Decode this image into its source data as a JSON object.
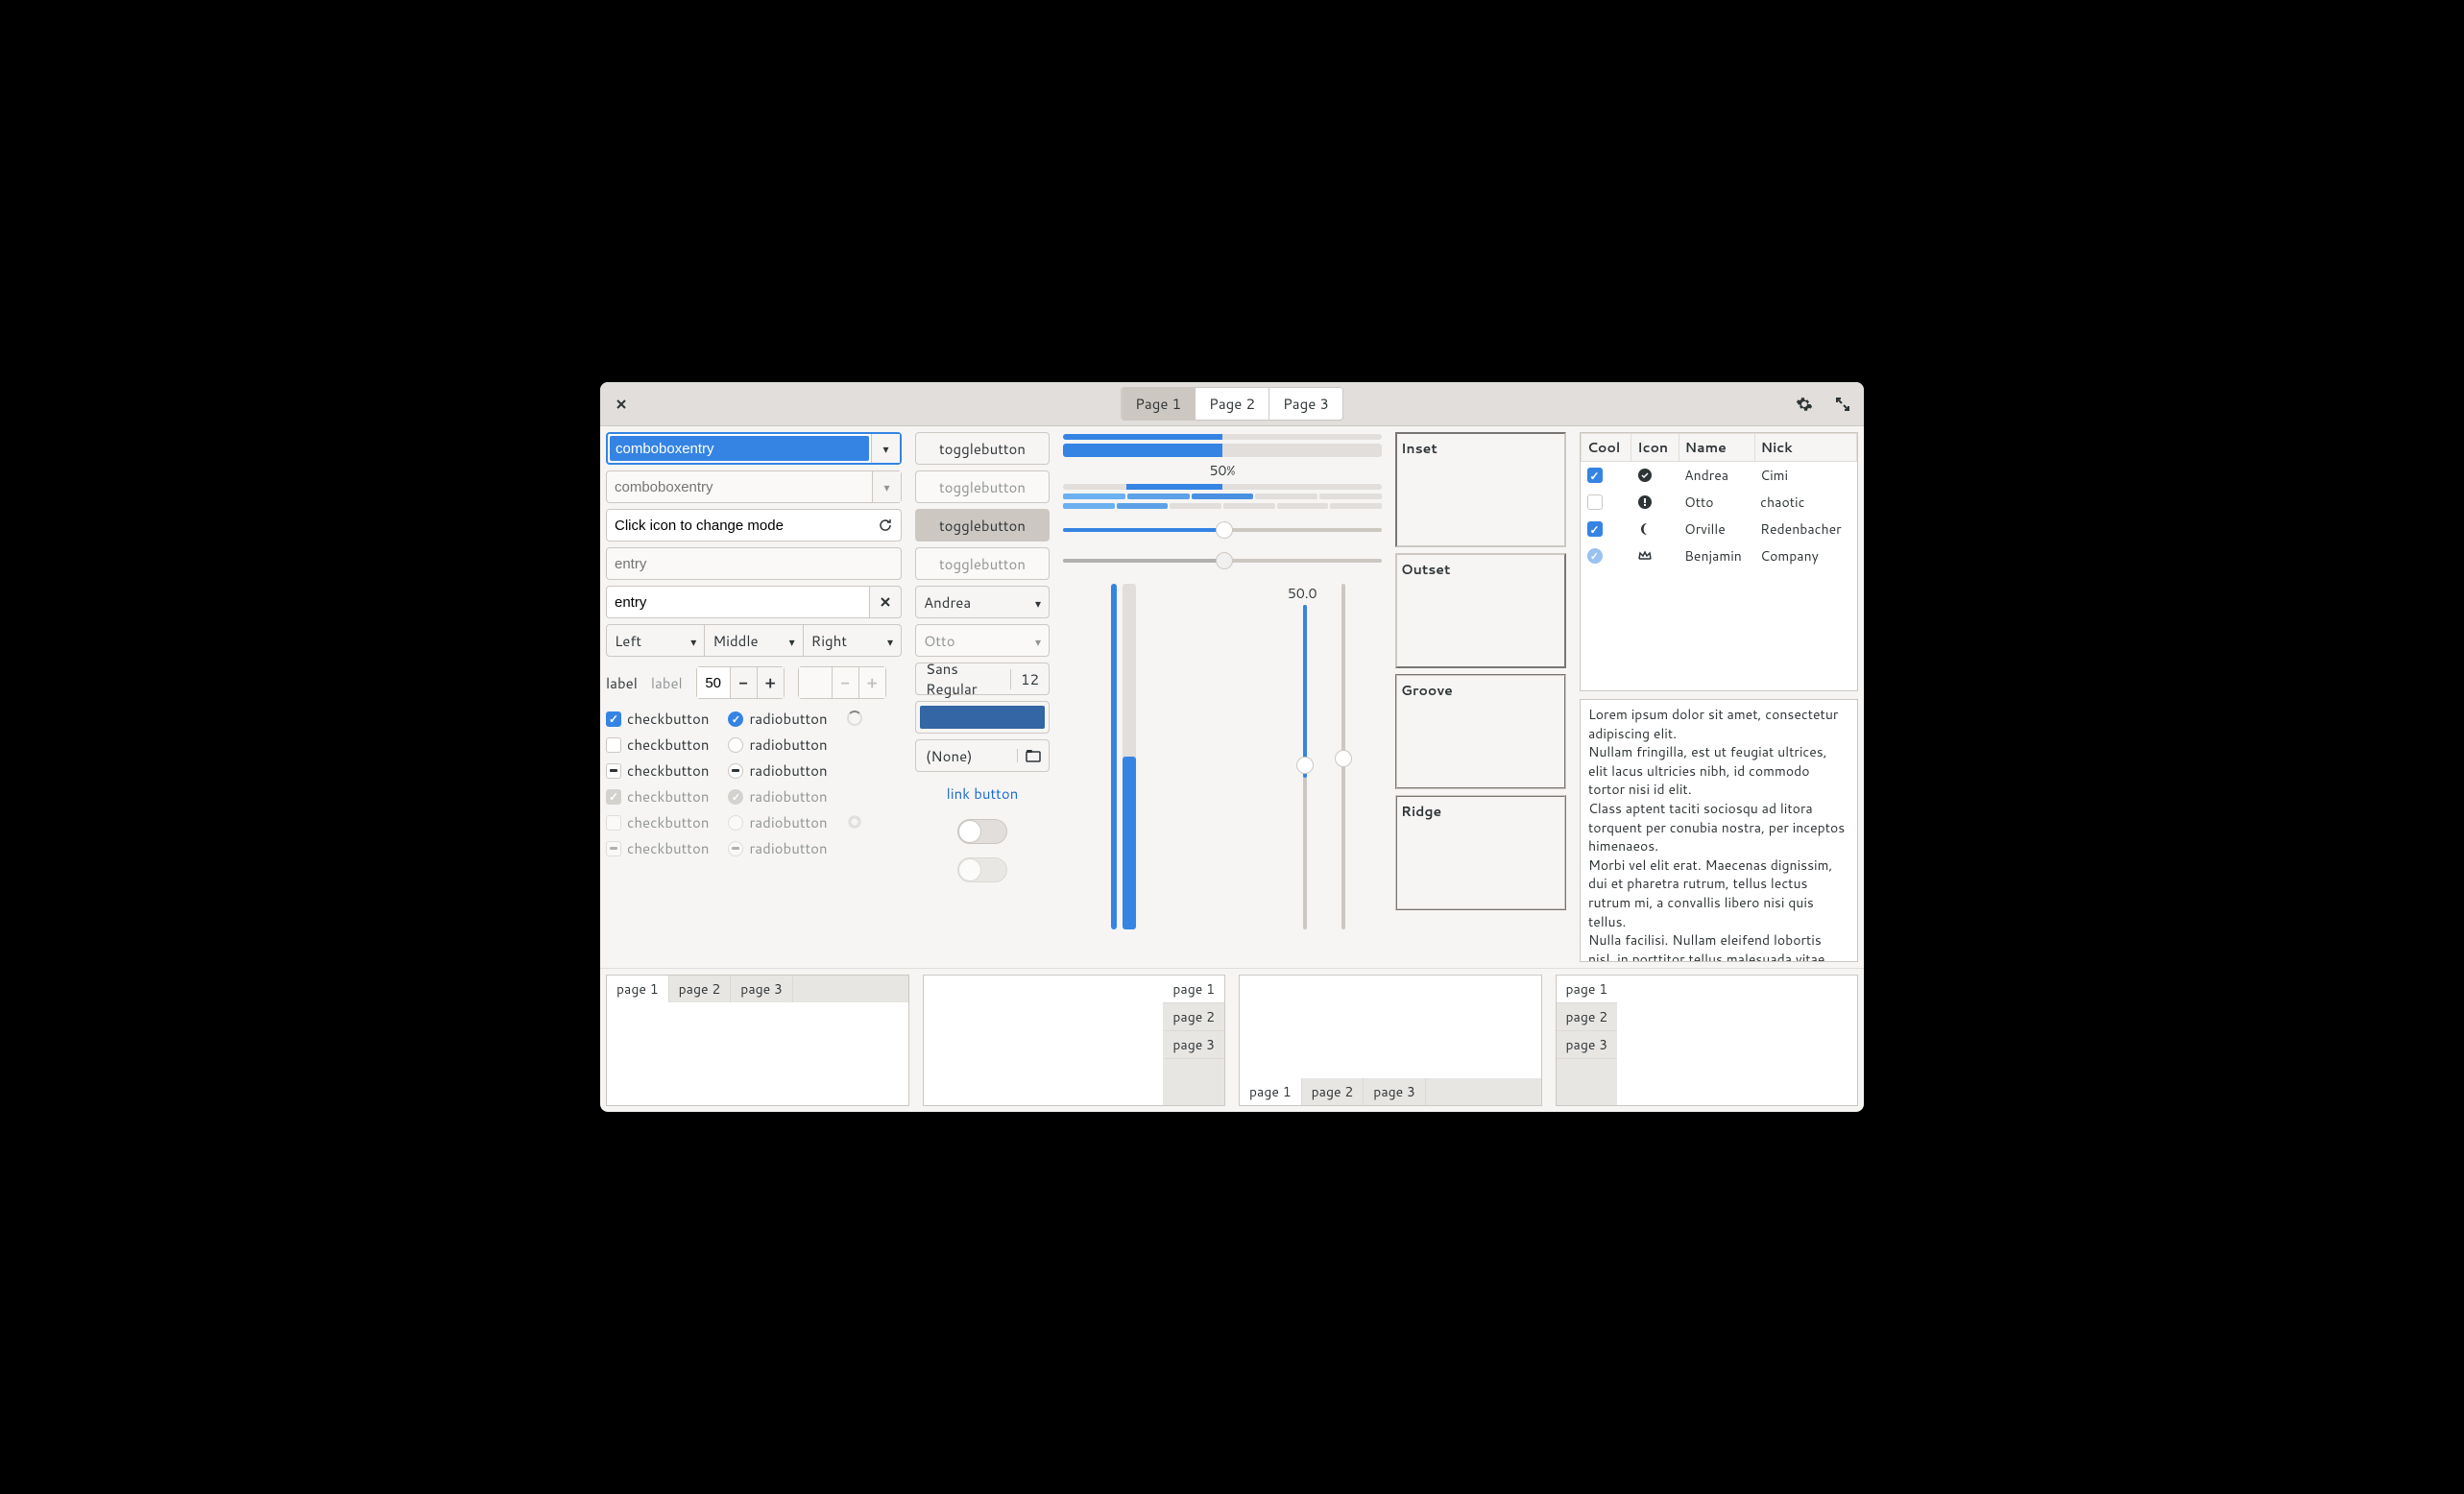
{
  "titlebar": {
    "tabs": [
      "Page 1",
      "Page 2",
      "Page 3"
    ],
    "active_tab": 0
  },
  "col1": {
    "combo1_value": "comboboxentry",
    "combo2_placeholder": "comboboxentry",
    "mode_entry": "Click icon to change mode",
    "entry_disabled_placeholder": "entry",
    "entry_value": "entry",
    "linked": [
      "Left",
      "Middle",
      "Right"
    ],
    "label1": "label",
    "label2": "label",
    "spin_value": "50",
    "check_label": "checkbutton",
    "radio_label": "radiobutton"
  },
  "col2": {
    "toggle_label": "togglebutton",
    "select1": "Andrea",
    "select2": "Otto",
    "font_name": "Sans Regular",
    "font_size": "12",
    "file_label": "(None)",
    "link_label": "link button",
    "color": "#3465a4"
  },
  "col3": {
    "progress_label": "50%",
    "vscale_label": "50.0"
  },
  "col4": {
    "frames": [
      "Inset",
      "Outset",
      "Groove",
      "Ridge"
    ]
  },
  "col5": {
    "headers": [
      "Cool",
      "Icon",
      "Name",
      "Nick"
    ],
    "rows": [
      {
        "cool": true,
        "icon": "check-circle",
        "name": "Andrea",
        "nick": "Cimi"
      },
      {
        "cool": false,
        "icon": "alert-circle",
        "name": "Otto",
        "nick": "chaotic"
      },
      {
        "cool": true,
        "icon": "moon",
        "name": "Orville",
        "nick": "Redenbacher"
      },
      {
        "cool": "semi",
        "icon": "crown",
        "name": "Benjamin",
        "nick": "Company"
      }
    ],
    "lorem": "Lorem ipsum dolor sit amet, consectetur adipiscing elit.\nNullam fringilla, est ut feugiat ultrices, elit lacus ultricies nibh, id commodo tortor nisi id elit.\nClass aptent taciti sociosqu ad litora torquent per conubia nostra, per inceptos himenaeos.\nMorbi vel elit erat. Maecenas dignissim, dui et pharetra rutrum, tellus lectus rutrum mi, a convallis libero nisi quis tellus.\nNulla facilisi. Nullam eleifend lobortis nisl, in porttitor tellus malesuada vitae.\nAenean lacus tellus, pellentesque quis molestie quis, fringilla in arcu."
  },
  "notebooks": {
    "tabs": [
      "page 1",
      "page 2",
      "page 3"
    ]
  }
}
